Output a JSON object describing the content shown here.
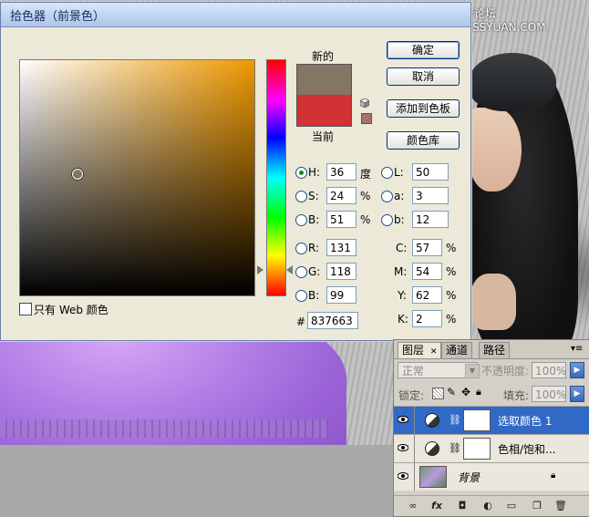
{
  "watermark": "思缘设计论坛 www.MISSYUAN.COM",
  "color_picker": {
    "title": "拾色器（前景色）",
    "new_label": "新的",
    "current_label": "当前",
    "new_color": "#837663",
    "current_color": "#d13233",
    "gamut_color": "#a6726a",
    "buttons": {
      "ok": "确定",
      "cancel": "取消",
      "add_to_swatches": "添加到色板",
      "color_libraries": "颜色库"
    },
    "fields": {
      "H": {
        "label": "H:",
        "value": "36",
        "unit": "度"
      },
      "S": {
        "label": "S:",
        "value": "24",
        "unit": "%"
      },
      "Bv": {
        "label": "B:",
        "value": "51",
        "unit": "%"
      },
      "L": {
        "label": "L:",
        "value": "50"
      },
      "a": {
        "label": "a:",
        "value": "3"
      },
      "b": {
        "label": "b:",
        "value": "12"
      },
      "R": {
        "label": "R:",
        "value": "131"
      },
      "G": {
        "label": "G:",
        "value": "118"
      },
      "Bc": {
        "label": "B:",
        "value": "99"
      },
      "C": {
        "label": "C:",
        "value": "57",
        "unit": "%"
      },
      "M": {
        "label": "M:",
        "value": "54",
        "unit": "%"
      },
      "Y": {
        "label": "Y:",
        "value": "62",
        "unit": "%"
      },
      "K": {
        "label": "K:",
        "value": "2",
        "unit": "%"
      },
      "hex": {
        "label": "#",
        "value": "837663"
      }
    },
    "web_only_label": "只有 Web 颜色"
  },
  "layers_panel": {
    "tabs": [
      "图层",
      "通道",
      "路径"
    ],
    "blend_mode": "正常",
    "opacity_label": "不透明度:",
    "opacity_value": "100%",
    "lock_label": "锁定:",
    "fill_label": "填充:",
    "fill_value": "100%",
    "layers": [
      {
        "name": "选取颜色 1",
        "selected": true
      },
      {
        "name": "色相/饱和...",
        "selected": false
      },
      {
        "name": "背景",
        "selected": false
      }
    ]
  }
}
